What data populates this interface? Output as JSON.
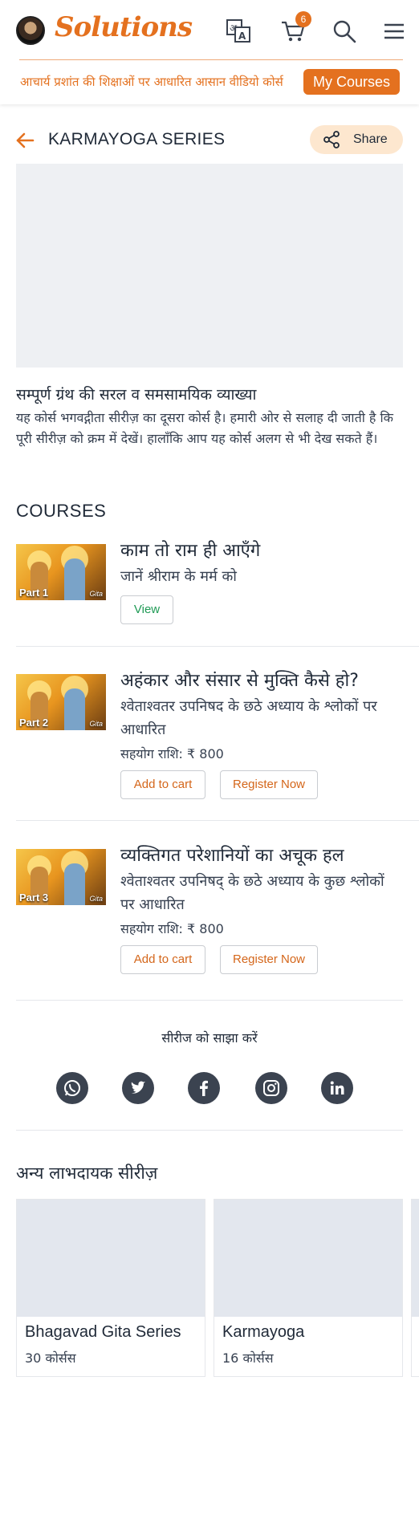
{
  "header": {
    "logo_text": "Solutions",
    "cart_count": "6",
    "tagline": "आचार्य प्रशांत की शिक्षाओं पर आधारित आसान वीडियो कोर्स",
    "my_courses_label": "My Courses",
    "accent_color": "#e4711f"
  },
  "page": {
    "title": "KARMAYOGA SERIES",
    "share_label": "Share",
    "description_title": "सम्पूर्ण ग्रंथ की सरल व समसामयिक व्याख्या",
    "description_text": "यह कोर्स भगवद्गीता सीरीज़ का दूसरा कोर्स है। हमारी ओर से सलाह दी जाती है कि पूरी सीरीज़ को क्रम में देखें। हालाँकि आप यह कोर्स अलग से भी देख सकते हैं।",
    "courses_heading": "COURSES"
  },
  "courses": [
    {
      "part": "Part 1",
      "title": "काम तो राम ही आएँगे",
      "subtitle": "जानें श्रीराम के मर्म को",
      "view_label": "View"
    },
    {
      "part": "Part 2",
      "title": "अहंकार और संसार से मुक्ति कैसे हो?",
      "subtitle": "श्वेताश्वतर उपनिषद के छठे अध्याय के श्लोकों पर आधारित",
      "price": "सहयोग राशि: ₹ 800",
      "add_to_cart_label": "Add to cart",
      "register_label": "Register Now"
    },
    {
      "part": "Part 3",
      "title": "व्यक्तिगत परेशानियों का अचूक हल",
      "subtitle": "श्वेताश्वतर उपनिषद् के छठे अध्याय के कुछ श्लोकों पर आधारित",
      "price": "सहयोग राशि: ₹ 800",
      "add_to_cart_label": "Add to cart",
      "register_label": "Register Now"
    }
  ],
  "share_series": {
    "label": "सीरीज को साझा करें",
    "icons": [
      "whatsapp-icon",
      "twitter-icon",
      "facebook-icon",
      "instagram-icon",
      "linkedin-icon"
    ]
  },
  "other_series": {
    "heading": "अन्य लाभदायक सीरीज़",
    "items": [
      {
        "name": "Bhagavad Gita Series",
        "count": "30 कोर्सस"
      },
      {
        "name": "Karmayoga",
        "count": "16 कोर्सस"
      }
    ]
  }
}
